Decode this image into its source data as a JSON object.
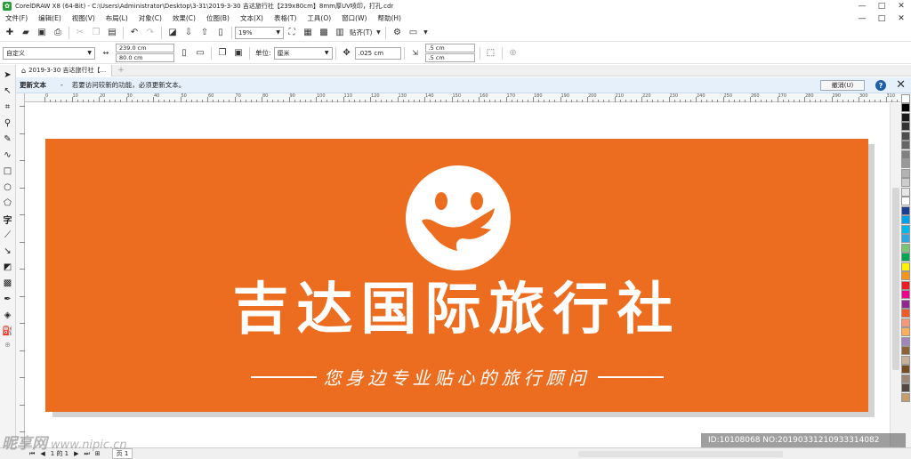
{
  "window": {
    "title": "CorelDRAW X8 (64-Bit) - C:\\Users\\Administrator\\Desktop\\3-31\\2019-3-30 吉达旅行社【239x80cm】8mm厚UV喷印，打孔.cdr",
    "min": "—",
    "max": "□",
    "close": "✕"
  },
  "menu": {
    "items": [
      "文件(F)",
      "编辑(E)",
      "视图(V)",
      "布局(L)",
      "对象(C)",
      "效果(C)",
      "位图(B)",
      "文本(X)",
      "表格(T)",
      "工具(O)",
      "窗口(W)",
      "帮助(H)"
    ]
  },
  "toolbar": {
    "zoom": "19%",
    "snap_label": "贴齐(T)"
  },
  "propbar": {
    "page_preset": "自定义",
    "width": "239.0 cm",
    "height": "80.0 cm",
    "units_label": "单位:",
    "units": "厘米",
    "nudge": ".025 cm",
    "dup_x": ".5 cm",
    "dup_y": ".5 cm"
  },
  "doc_tab": {
    "label": "2019-3-30 吉达旅行社【...",
    "add": "+"
  },
  "infobar": {
    "title": "更新文本",
    "sep": "-",
    "message": "若要访问较新的功能，必须更新文本。",
    "undo_button": "撤消(U)",
    "help": "?",
    "close": "✕"
  },
  "ruler": {
    "unit": "厘米",
    "labels": [
      "0",
      "10",
      "20",
      "30",
      "40",
      "50",
      "60",
      "70",
      "80",
      "90",
      "100",
      "110",
      "120",
      "130",
      "140",
      "150",
      "160",
      "170",
      "180",
      "190",
      "200",
      "210",
      "220",
      "230",
      "240",
      "250",
      "260",
      "270",
      "280",
      "290",
      "300",
      "310",
      "320"
    ]
  },
  "sign": {
    "bg_color": "#ec6d1f",
    "text_color": "#ffffff",
    "headline": "吉达国际旅行社",
    "slogan": "您身边专业贴心的旅行顾问",
    "logo_icon": "smiling-face-icon"
  },
  "palette": {
    "colors": [
      "#ffffff",
      "#000000",
      "#1a1a1a",
      "#333333",
      "#4d4d4d",
      "#666666",
      "#808080",
      "#999999",
      "#b3b3b3",
      "#cccccc",
      "#e6e6e6",
      "#ffffff",
      "#1c3f94",
      "#00a0e9",
      "#00b7ee",
      "#2ea7e0",
      "#7cc576",
      "#00a651",
      "#fff200",
      "#f7941d",
      "#ed1c24",
      "#ec008c",
      "#92278f",
      "#f15a24",
      "#f7977a",
      "#fbaf5d",
      "#a186be",
      "#8c6239",
      "#c7b299",
      "#754c24",
      "#998675",
      "#534741",
      "#c69c6d"
    ]
  },
  "status": {
    "page_of": "1 的 1",
    "page_tab": "页 1"
  },
  "watermarks": {
    "left_brand": "昵享网",
    "left_url": "www.nipic.cn",
    "right_id": "ID:10108068 NO:20190331210933314082"
  }
}
